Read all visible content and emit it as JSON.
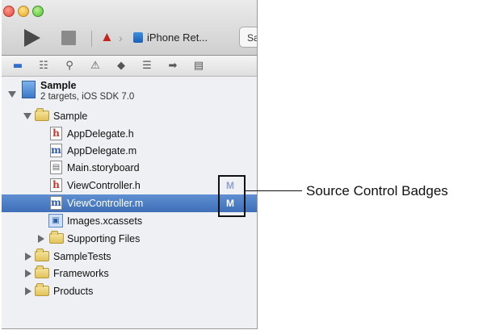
{
  "toolbar": {
    "device_label": "iPhone Ret...",
    "tab_text": "Sa"
  },
  "project": {
    "name": "Sample",
    "subtitle": "2 targets, iOS SDK 7.0"
  },
  "tree": {
    "items": [
      {
        "label": "Sample",
        "kind": "folder",
        "expanded": true
      },
      {
        "label": "AppDelegate.h",
        "kind": "h-file"
      },
      {
        "label": "AppDelegate.m",
        "kind": "m-file"
      },
      {
        "label": "Main.storyboard",
        "kind": "storyboard"
      },
      {
        "label": "ViewController.h",
        "kind": "h-file",
        "badge": "M"
      },
      {
        "label": "ViewController.m",
        "kind": "m-file",
        "badge": "M",
        "selected": true
      },
      {
        "label": "Images.xcassets",
        "kind": "xcassets"
      },
      {
        "label": "Supporting Files",
        "kind": "folder",
        "expanded": false
      },
      {
        "label": "SampleTests",
        "kind": "folder",
        "expanded": false
      },
      {
        "label": "Frameworks",
        "kind": "folder",
        "expanded": false
      },
      {
        "label": "Products",
        "kind": "folder",
        "expanded": false
      }
    ]
  },
  "callout": {
    "text": "Source Control Badges"
  },
  "colors": {
    "selection": "#4a7cc4",
    "badge": "#8fa4c8"
  }
}
